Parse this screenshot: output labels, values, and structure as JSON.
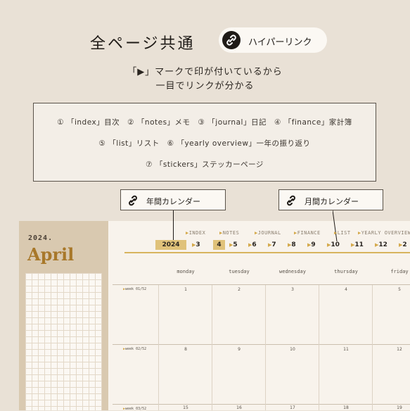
{
  "header": {
    "title": "全ページ共通",
    "pill_label": "ハイパーリンク",
    "subtitle_line1": "「▶」マークで印が付いているから",
    "subtitle_line2": "一目でリンクが分かる"
  },
  "link_list": {
    "row1": "① 「index」目次　② 「notes」メモ　③ 「journal」日記　④ 「finance」家計簿",
    "row2": "⑤ 「list」リスト　⑥ 「yearly overview」一年の振り返り",
    "row3": "⑦ 「stickers」ステッカーページ"
  },
  "callouts": {
    "yearly": "年間カレンダー",
    "monthly": "月間カレンダー"
  },
  "planner": {
    "year": "2024.",
    "month": "April",
    "nav": [
      "INDEX",
      "NOTES",
      "JOURNAL",
      "FINANCE",
      "LIST",
      "YEARLY OVERVIEW"
    ],
    "year_tab": "2024",
    "months": [
      "3",
      "4",
      "5",
      "6",
      "7",
      "8",
      "9",
      "10",
      "11",
      "12",
      "2"
    ],
    "days": [
      "monday",
      "tuesday",
      "wednesday",
      "thursday",
      "friday"
    ],
    "weeks": [
      "week 01/52",
      "week 02/52",
      "week 03/52"
    ],
    "week1_dates": [
      "1",
      "2",
      "3",
      "4",
      "5"
    ],
    "week2_dates": [
      "8",
      "9",
      "10",
      "11",
      "12"
    ],
    "week3_dates": [
      "15",
      "16",
      "17",
      "18",
      "19"
    ]
  },
  "colors": {
    "accent_gold": "#e0c27a",
    "month_text": "#a8782a",
    "background": "#e9e1d6"
  },
  "icons": {
    "link": "link-icon",
    "marker": "triangle-marker-icon"
  }
}
